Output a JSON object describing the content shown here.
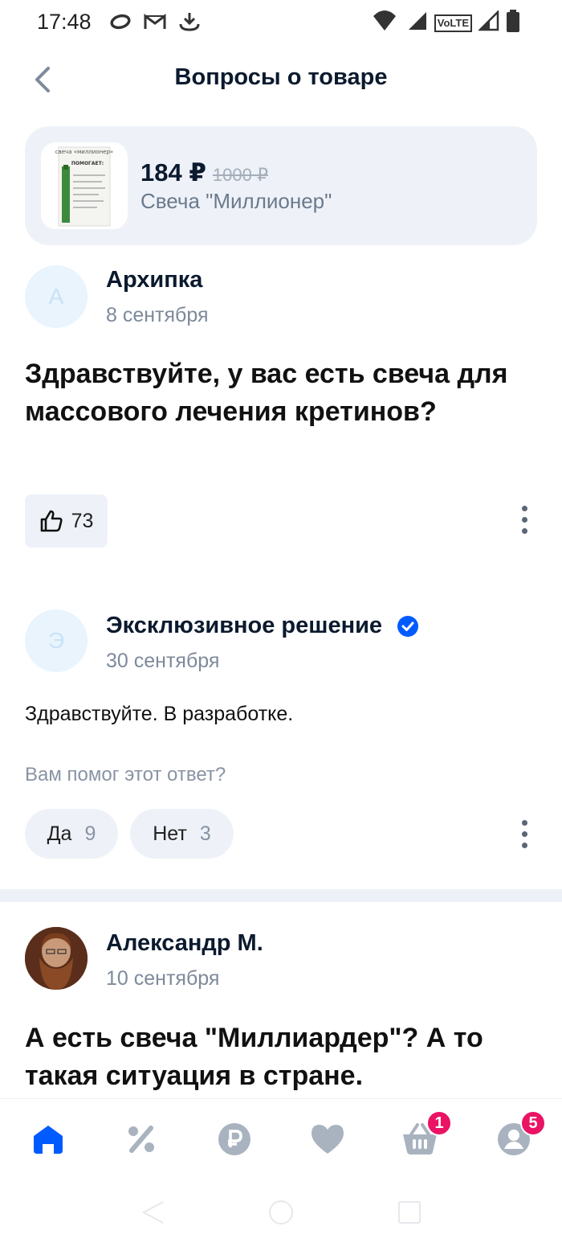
{
  "status_bar": {
    "time": "17:48",
    "icons_left": [
      "sync-icon",
      "gmail-icon",
      "download-icon"
    ],
    "icons_right": [
      "wifi-icon",
      "signal-icon",
      "volte-icon",
      "signal-icon",
      "battery-icon"
    ],
    "volte_label": "VoLTE"
  },
  "header": {
    "title": "Вопросы о товаре",
    "back_icon": "chevron-left-icon"
  },
  "product": {
    "price": "184 ₽",
    "old_price": "1000 ₽",
    "name": "Свеча \"Миллионер\"",
    "thumb_caption": "свеча «миллионер»",
    "thumb_label": "ПОМОГАЕТ:"
  },
  "question": {
    "author_initial": "А",
    "author_name": "Архипка",
    "date": "8 сентября",
    "text": "Здравствуйте, у вас есть свеча для массового лечения кретинов?",
    "likes": "73"
  },
  "answer": {
    "author_initial": "Э",
    "author_name": "Эксклюзивное решение",
    "verified": true,
    "date": "30 сентября",
    "text": "Здравствуйте. В разработке.",
    "helpful_prompt": "Вам помог этот ответ?",
    "yes_label": "Да",
    "yes_count": "9",
    "no_label": "Нет",
    "no_count": "3"
  },
  "question2": {
    "author_name": "Александр М.",
    "date": "10 сентября",
    "text": "А есть свеча \"Миллиардер\"? А то такая ситуация в стране."
  },
  "bottom_nav": {
    "items": [
      {
        "icon": "home-icon",
        "active": true
      },
      {
        "icon": "percent-icon",
        "active": false
      },
      {
        "icon": "ruble-icon",
        "active": false
      },
      {
        "icon": "heart-icon",
        "active": false
      },
      {
        "icon": "basket-icon",
        "active": false,
        "badge": "1"
      },
      {
        "icon": "profile-icon",
        "active": false,
        "badge": "5"
      }
    ]
  },
  "colors": {
    "accent": "#005bff",
    "badge": "#ea1364",
    "inactive_icon": "#a9b3c0",
    "card_bg": "#eef2f8"
  }
}
